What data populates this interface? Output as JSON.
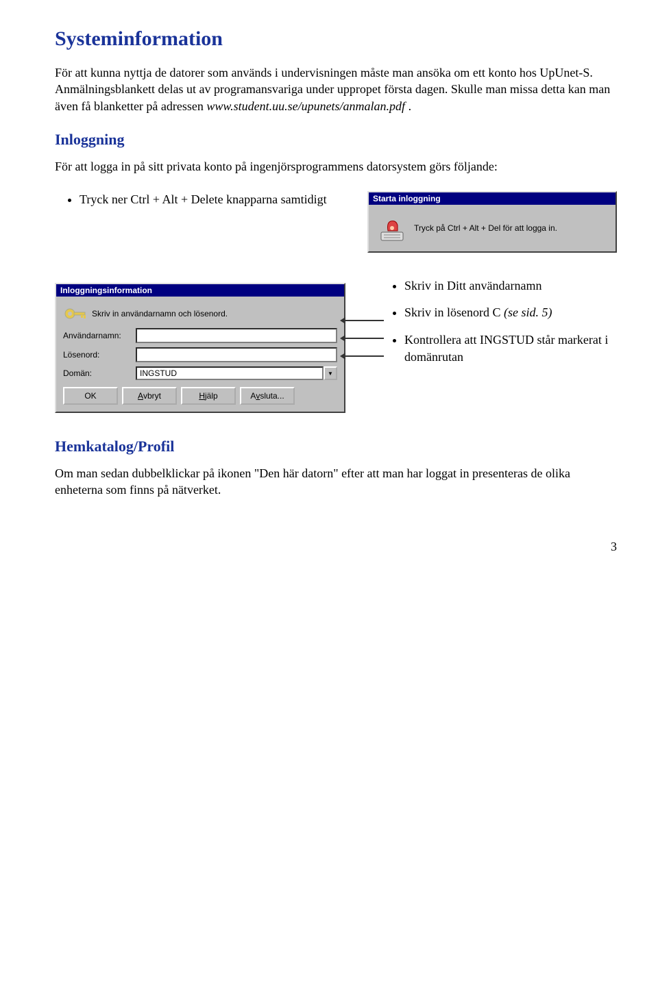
{
  "headings": {
    "systeminformation": "Systeminformation",
    "inloggning": "Inloggning",
    "hemkatalog": "Hemkatalog/Profil"
  },
  "paragraphs": {
    "p1a": "För att kunna nyttja de datorer som används i undervisningen måste man ansöka om ett konto hos UpUnet-S. Anmälningsblankett delas ut av programansvariga under uppropet första dagen. Skulle man missa detta kan man även få blanketter på adressen ",
    "p1b": "www.student.uu.se/upunets/anmalan.pdf",
    "p1c": " .",
    "p2": "För att logga in på sitt privata konto på ingenjörsprogrammens datorsystem görs följande:",
    "p3": "Om man sedan dubbelklickar på ikonen \"Den här datorn\" efter att man har loggat in presenteras de olika enheterna som finns på nätverket."
  },
  "bullets": {
    "b1": "Tryck ner Ctrl + Alt + Delete knapparna samtidigt",
    "b2": "Skriv in Ditt användarnamn",
    "b3a": "Skriv in lösenord C ",
    "b3b": "(se sid. 5)",
    "b4": "Kontrollera att INGSTUD står markerat i domänrutan"
  },
  "dlg1": {
    "title": "Starta inloggning",
    "msg": "Tryck på Ctrl + Alt + Del för att logga in."
  },
  "dlg2": {
    "title": "Inloggningsinformation",
    "instruction": "Skriv in användarnamn och lösenord.",
    "labels": {
      "user": "Användarnamn:",
      "pass": "Lösenord:",
      "domain": "Domän:"
    },
    "fields": {
      "user": "",
      "pass": "",
      "domain": "INGSTUD"
    },
    "buttons": {
      "ok": "OK",
      "cancel_pre": "",
      "cancel_u": "A",
      "cancel_post": "vbryt",
      "help_pre": "",
      "help_u": "H",
      "help_post": "jälp",
      "end_pre": "A",
      "end_u": "v",
      "end_post": "sluta..."
    }
  },
  "page_number": "3"
}
